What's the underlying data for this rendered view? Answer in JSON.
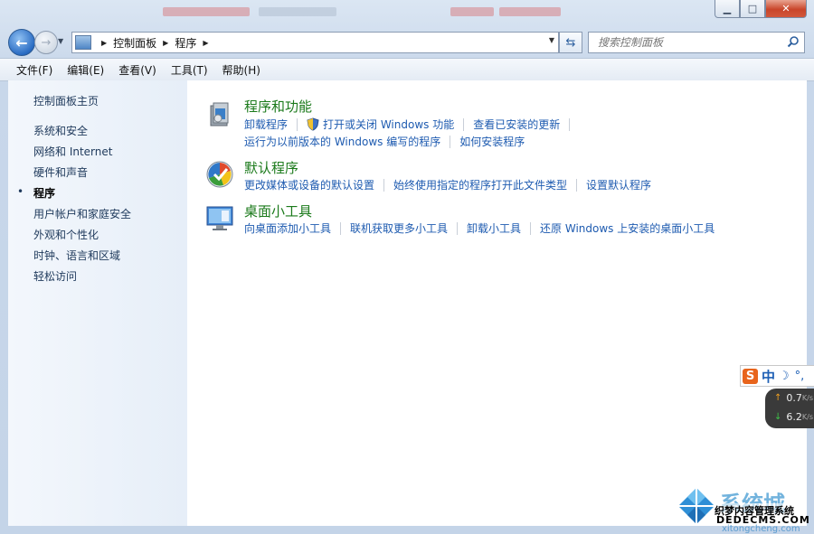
{
  "window": {
    "caption_buttons": {
      "minimize": "▁",
      "maximize": "□",
      "close": "✕"
    }
  },
  "nav": {
    "back_glyph": "←",
    "forward_glyph": "→",
    "history_glyph": "▼",
    "refresh_glyph": "⇆",
    "address_dropdown_glyph": "▼",
    "breadcrumb": [
      {
        "label": "控制面板"
      },
      {
        "label": "程序"
      }
    ],
    "search_placeholder": "搜索控制面板"
  },
  "menubar": {
    "items": [
      "文件(F)",
      "编辑(E)",
      "查看(V)",
      "工具(T)",
      "帮助(H)"
    ]
  },
  "sidebar": {
    "home": "控制面板主页",
    "items": [
      "系统和安全",
      "网络和 Internet",
      "硬件和声音",
      "程序",
      "用户帐户和家庭安全",
      "外观和个性化",
      "时钟、语言和区域",
      "轻松访问"
    ],
    "current_bullet": "•"
  },
  "main": {
    "categories": [
      {
        "title": "程序和功能",
        "icon": "programs-features-icon",
        "tasks": [
          [
            "卸载程序",
            "打开或关闭 Windows 功能",
            "查看已安装的更新"
          ],
          [
            "运行为以前版本的 Windows 编写的程序",
            "如何安装程序"
          ]
        ]
      },
      {
        "title": "默认程序",
        "icon": "default-programs-icon",
        "tasks": [
          [
            "更改媒体或设备的默认设置",
            "始终使用指定的程序打开此文件类型",
            "设置默认程序"
          ]
        ]
      },
      {
        "title": "桌面小工具",
        "icon": "desktop-gadgets-icon",
        "tasks": [
          [
            "向桌面添加小工具",
            "联机获取更多小工具",
            "卸载小工具",
            "还原 Windows 上安装的桌面小工具"
          ]
        ]
      }
    ]
  },
  "overlays": {
    "ime": {
      "logo": "S",
      "mode": "中",
      "moon": "☽",
      "punct": "°,"
    },
    "netmon": {
      "up": "0.7",
      "down": "6.2",
      "unit": "K/s",
      "up_arrow": "↑",
      "down_arrow": "↓"
    },
    "watermark": {
      "brand": "系统城",
      "line1": "织梦内容管理系统",
      "line2": "DEDECMS.COM",
      "line3": "xitongcheng.com"
    }
  },
  "colors": {
    "category_title": "#1b7a1b",
    "task_link": "#1e5bb0",
    "sidebar_link": "#1e395b",
    "close_button": "#c9452a"
  }
}
